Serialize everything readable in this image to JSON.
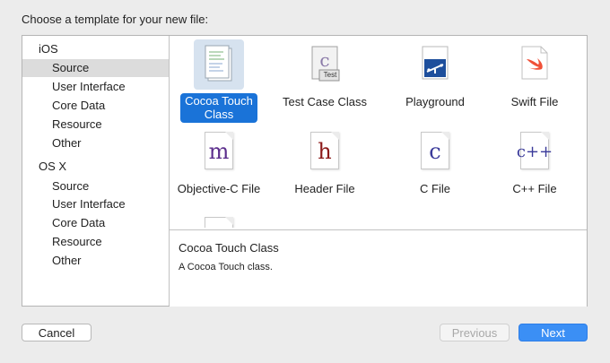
{
  "header": {
    "prompt": "Choose a template for your new file:"
  },
  "sidebar": {
    "ios_title": "iOS",
    "ios_items": [
      "Source",
      "User Interface",
      "Core Data",
      "Resource",
      "Other"
    ],
    "osx_title": "OS X",
    "osx_items": [
      "Source",
      "User Interface",
      "Core Data",
      "Resource",
      "Other"
    ],
    "selected": "iOS / Source"
  },
  "templates": [
    {
      "label": "Cocoa Touch\nClass",
      "icon": "cocoa-touch-class-icon",
      "selected": true
    },
    {
      "label": "Test Case Class",
      "icon": "test-case-class-icon",
      "badge": "Test"
    },
    {
      "label": "Playground",
      "icon": "playground-icon"
    },
    {
      "label": "Swift File",
      "icon": "swift-file-icon"
    },
    {
      "label": "Objective-C File",
      "icon": "objective-c-file-icon",
      "glyph": "m"
    },
    {
      "label": "Header File",
      "icon": "header-file-icon",
      "glyph": "h"
    },
    {
      "label": "C File",
      "icon": "c-file-icon",
      "glyph": "c"
    },
    {
      "label": "C++ File",
      "icon": "cpp-file-icon",
      "glyph": "c++"
    }
  ],
  "description": {
    "title": "Cocoa Touch Class",
    "text": "A Cocoa Touch class."
  },
  "buttons": {
    "cancel": "Cancel",
    "previous": "Previous",
    "next": "Next"
  },
  "colors": {
    "selection_blue": "#1a73d8",
    "next_button": "#3b8ff5",
    "objc_m": "#5b2d8c",
    "header_h": "#8c1a1a",
    "c_glyph": "#3a3a9a",
    "swift_orange": "#f05138",
    "playground_blue": "#1e4f9c"
  }
}
